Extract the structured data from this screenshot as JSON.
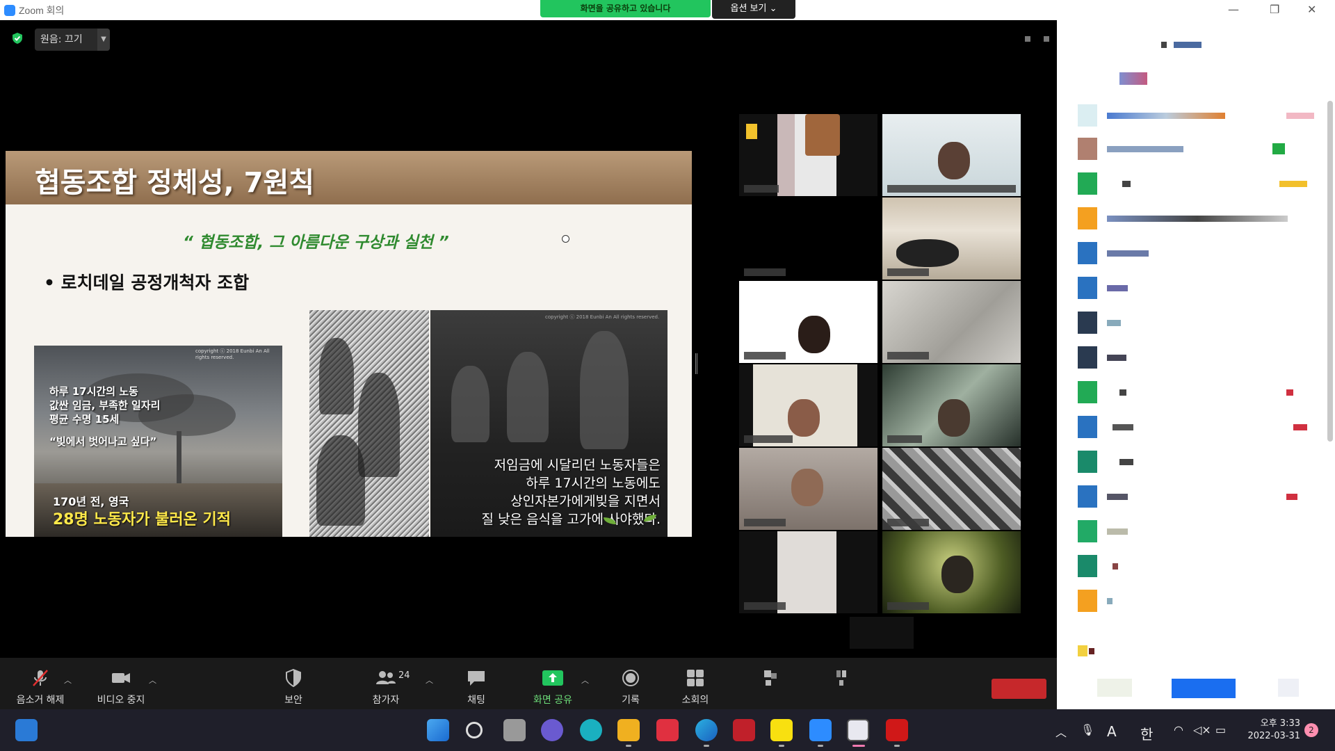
{
  "window": {
    "title": "Zoom 회의"
  },
  "share_banner": {
    "text": "화면을 공유하고 있습니다"
  },
  "options_button": {
    "label": "옵션 보기 ⌄"
  },
  "audio": {
    "label": "원음: 끄기"
  },
  "slide": {
    "title": "협동조합 정체성, 7원칙",
    "quote": "“ 협동조합, 그 아름다운 구상과 실천 ”",
    "bullet": "• 로치데일 공정개척자 조합",
    "left_photo": {
      "lines": [
        "하루 17시간의 노동",
        "값싼 임금, 부족한 일자리",
        "평균 수명 15세"
      ],
      "quote": "“빚에서 벗어나고 싶다”",
      "caption1": "170년 전, 영국",
      "caption2": "28명 노동자가 불러온 기적",
      "copyright": "copyright ⓒ 2018 Eunbi An All rights reserved."
    },
    "right_photo": {
      "copyright": "copyright ⓒ 2018 Eunbi An All rights reserved.",
      "lines": [
        "저임금에 시달리던 노동자들은",
        "하루 17시간의 노동에도",
        "상인자본가에게빚을 지면서",
        "질 낮은 음식을 고가에 사야했다."
      ]
    }
  },
  "toolbar": {
    "mute": "음소거 해제",
    "video": "비디오 중지",
    "security": "보안",
    "participants": "참가자",
    "participant_count": "24",
    "chat": "채팅",
    "share": "화면 공유",
    "record": "기록",
    "breakout": "소회의"
  },
  "taskbar": {
    "time": "오후 3:33",
    "date": "2022-03-31",
    "notifications": "2",
    "ime_a": "A",
    "ime_han": "한"
  },
  "colors": {
    "accent_green": "#22c55e",
    "zoom_blue": "#2d8cff",
    "end_red": "#c6282b",
    "speaker_green": "#8ce02a"
  }
}
